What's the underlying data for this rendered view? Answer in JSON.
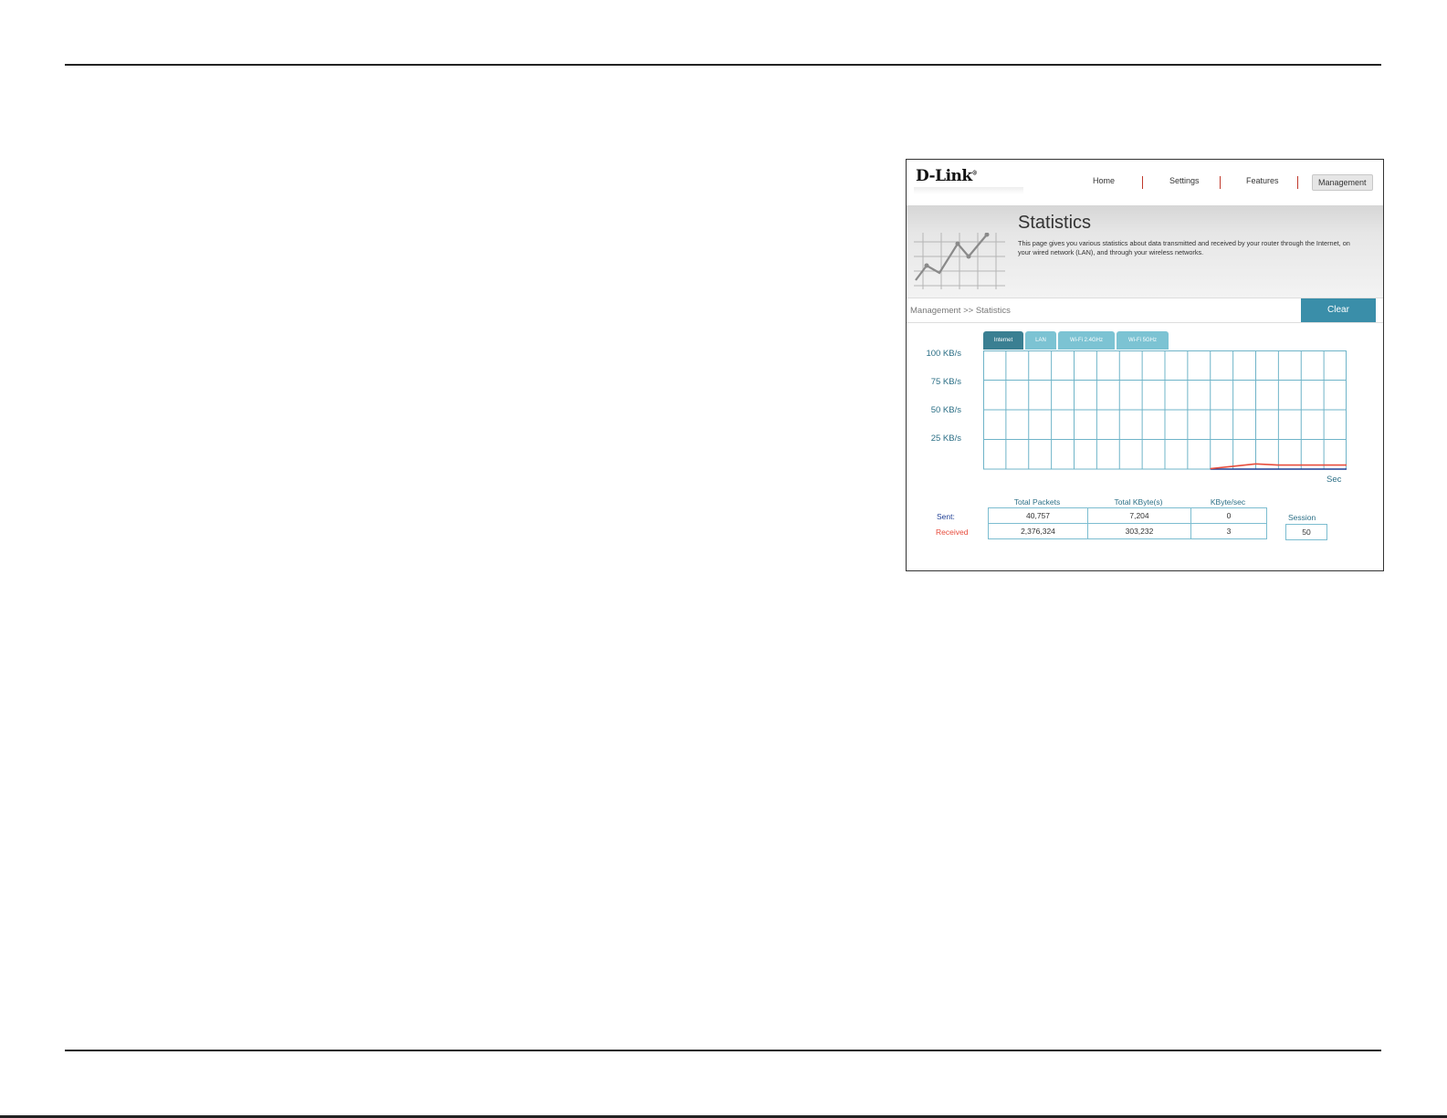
{
  "router": {
    "logo_text": "D-Link",
    "nav": {
      "home": "Home",
      "settings": "Settings",
      "features": "Features",
      "management": "Management"
    },
    "page_title": "Statistics",
    "description": "This page gives you various statistics about data transmitted and received by your router through the Internet, on your wired network (LAN), and through your wireless networks.",
    "breadcrumb": "Management >> Statistics",
    "clear_label": "Clear",
    "tabs": [
      "Internet",
      "LAN",
      "Wi-Fi 2.4GHz",
      "Wi-Fi 5GHz"
    ],
    "active_tab": "Internet",
    "table": {
      "headers": [
        "Total Packets",
        "Total KByte(s)",
        "KByte/sec"
      ],
      "rows": [
        {
          "label": "Sent:",
          "values": [
            "40,757",
            "7,204",
            "0"
          ]
        },
        {
          "label": "Received",
          "values": [
            "2,376,324",
            "303,232",
            "3"
          ]
        }
      ],
      "session_label": "Session",
      "session_value": "50"
    },
    "colors": {
      "accent": "#3a8ea9",
      "sent": "#1f3f94",
      "received": "#e74c3c",
      "nav_separator": "#c0392b"
    }
  },
  "chart_data": {
    "type": "line",
    "y_tick_labels": [
      "100 KB/s",
      "75 KB/s",
      "50 KB/s",
      "25 KB/s"
    ],
    "xlabel": "Sec",
    "ylim": [
      0,
      100
    ],
    "grid": true,
    "x": [
      0,
      1,
      2,
      3,
      4,
      5,
      6,
      7,
      8,
      9,
      10,
      11,
      12,
      13,
      14,
      15,
      16
    ],
    "series": [
      {
        "name": "Sent:",
        "color": "#1f3f94",
        "values": [
          null,
          null,
          null,
          null,
          null,
          null,
          null,
          null,
          null,
          null,
          0,
          0,
          0,
          0,
          0,
          0,
          0
        ]
      },
      {
        "name": "Received",
        "color": "#e74c3c",
        "values": [
          null,
          null,
          null,
          null,
          null,
          null,
          null,
          null,
          null,
          null,
          0,
          2,
          4,
          3,
          3,
          3,
          3
        ]
      }
    ]
  }
}
